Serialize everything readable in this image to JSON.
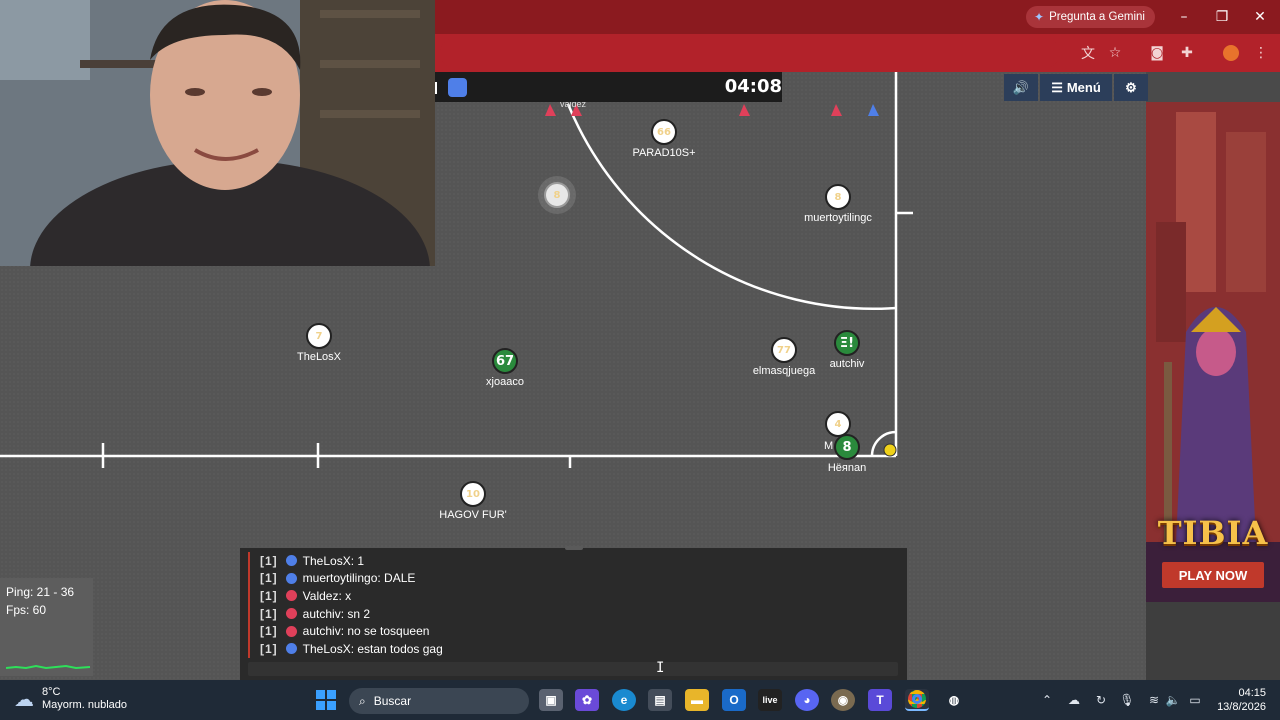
{
  "browser": {
    "gemini_label": "Pregunta a Gemini",
    "window_controls": {
      "minimize": "–",
      "restore": "❐",
      "close": "✕"
    },
    "toolbar_icons": [
      "translate-icon",
      "star-icon",
      "glasses-icon",
      "extensions-icon",
      "profile-icon",
      "more-icon"
    ]
  },
  "game": {
    "timer": "04:08",
    "menu": {
      "sound_label": "🔊",
      "menu_label": "Menú",
      "settings_label": "⚙"
    },
    "players": [
      {
        "name": "PARAD10S+",
        "number": "66",
        "team": "white"
      },
      {
        "name": "",
        "number": "8",
        "team": "ghost"
      },
      {
        "name": "muertoytilingc",
        "number": "8",
        "team": "white"
      },
      {
        "name": "TheLosX",
        "number": "7",
        "team": "white"
      },
      {
        "name": "xjoaaco",
        "number": "67",
        "team": "green"
      },
      {
        "name": "elmasqjuega",
        "number": "77",
        "team": "white"
      },
      {
        "name": "autchiv",
        "number": "Ξ!",
        "team": "green"
      },
      {
        "name": "M",
        "number": "4",
        "team": "white"
      },
      {
        "name": "Hёяnan",
        "number": "8",
        "team": "green"
      },
      {
        "name": "HAGOV FUR'",
        "number": "10",
        "team": "white"
      },
      {
        "name": "valdez",
        "number": "",
        "team": "marker"
      }
    ]
  },
  "chat": {
    "lines": [
      {
        "channel": "[1]",
        "dot_color": "#4f7fe8",
        "text": "TheLosX: 1"
      },
      {
        "channel": "[1]",
        "dot_color": "#4f7fe8",
        "text": "muertoytilingo: DALE"
      },
      {
        "channel": "[1]",
        "dot_color": "#e0405a",
        "text": "Valdez: x"
      },
      {
        "channel": "[1]",
        "dot_color": "#e0405a",
        "text": "autchiv: sn 2"
      },
      {
        "channel": "[1]",
        "dot_color": "#e0405a",
        "text": "autchiv: no se tosqueen"
      },
      {
        "channel": "[1]",
        "dot_color": "#4f7fe8",
        "text": "TheLosX: estan todos gag"
      }
    ]
  },
  "stats": {
    "ping": "Ping: 21 - 36",
    "fps": "Fps: 60"
  },
  "ad": {
    "logo": "TIBIA",
    "cta": "PLAY NOW"
  },
  "taskbar": {
    "weather_temp": "8°C",
    "weather_desc": "Mayorm. nublado",
    "search_placeholder": "Buscar",
    "live_label": "live",
    "time": "04:15",
    "date": "13/8/2026"
  },
  "colors": {
    "team_blue": "#4f7fe8",
    "team_red": "#e0405a",
    "browser_red": "#b2222a",
    "green_team": "#2a8a3c"
  }
}
